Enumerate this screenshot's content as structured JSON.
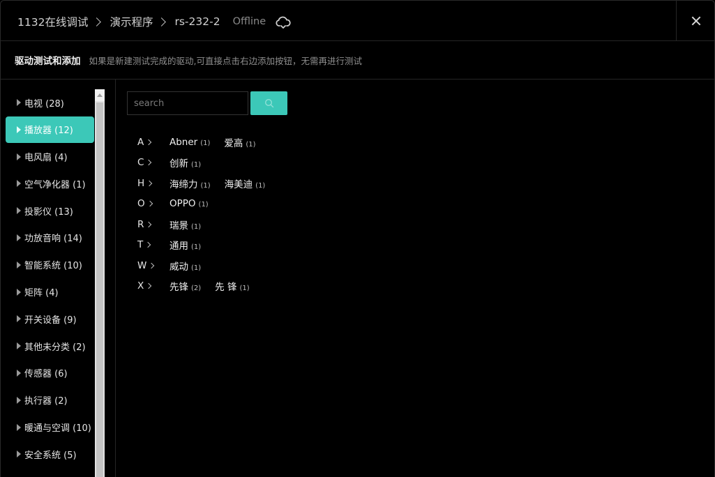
{
  "header": {
    "breadcrumbs": [
      "1132在线调试",
      "演示程序",
      "rs-232-2"
    ],
    "status": "Offline",
    "cloud_icon": "cloud-sync-icon",
    "close_icon": "close-icon"
  },
  "subheader": {
    "title": "驱动测试和添加",
    "hint": "如果是新建测试完成的驱动,可直接点击右边添加按钮，无需再进行测试"
  },
  "sidebar": {
    "items": [
      {
        "label": "电视 (28)",
        "active": false
      },
      {
        "label": "播放器 (12)",
        "active": true
      },
      {
        "label": "电风扇 (4)",
        "active": false
      },
      {
        "label": "空气净化器 (1)",
        "active": false
      },
      {
        "label": "投影仪 (13)",
        "active": false
      },
      {
        "label": "功放音响 (14)",
        "active": false
      },
      {
        "label": "智能系统 (10)",
        "active": false
      },
      {
        "label": "矩阵 (4)",
        "active": false
      },
      {
        "label": "开关设备 (9)",
        "active": false
      },
      {
        "label": "其他未分类 (2)",
        "active": false
      },
      {
        "label": "传感器 (6)",
        "active": false
      },
      {
        "label": "执行器 (2)",
        "active": false
      },
      {
        "label": "暖通与空调 (10)",
        "active": false
      },
      {
        "label": "安全系统 (5)",
        "active": false
      }
    ]
  },
  "search": {
    "placeholder": "search",
    "button_icon": "search-icon"
  },
  "brands": [
    {
      "letter": "A",
      "items": [
        {
          "name": "Abner",
          "count": "(1)"
        },
        {
          "name": "爱高",
          "count": "(1)"
        }
      ]
    },
    {
      "letter": "C",
      "items": [
        {
          "name": "创新",
          "count": "(1)"
        }
      ]
    },
    {
      "letter": "H",
      "items": [
        {
          "name": "海缔力",
          "count": "(1)"
        },
        {
          "name": "海美迪",
          "count": "(1)"
        }
      ]
    },
    {
      "letter": "O",
      "items": [
        {
          "name": "OPPO",
          "count": "(1)"
        }
      ]
    },
    {
      "letter": "R",
      "items": [
        {
          "name": "瑞景",
          "count": "(1)"
        }
      ]
    },
    {
      "letter": "T",
      "items": [
        {
          "name": "通用",
          "count": "(1)"
        }
      ]
    },
    {
      "letter": "W",
      "items": [
        {
          "name": "威动",
          "count": "(1)"
        }
      ]
    },
    {
      "letter": "X",
      "items": [
        {
          "name": "先锋",
          "count": "(2)"
        },
        {
          "name": "先 锋",
          "count": "(1)"
        }
      ]
    }
  ],
  "colors": {
    "accent": "#3cc8b8",
    "background": "#000000"
  }
}
